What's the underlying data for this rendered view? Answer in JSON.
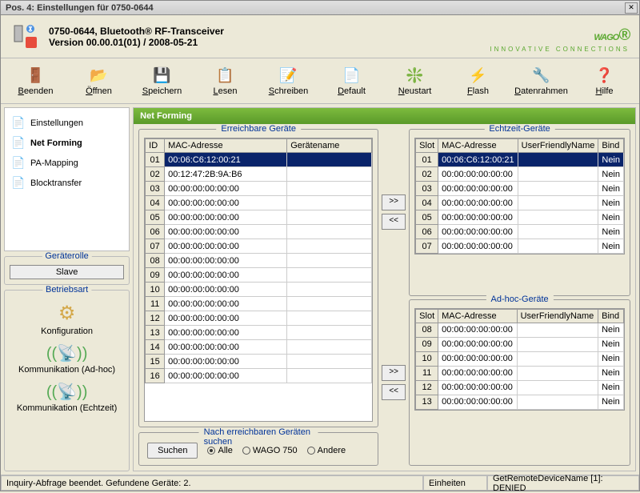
{
  "window": {
    "title": "Pos. 4: Einstellungen für 0750-0644"
  },
  "header": {
    "line1": "0750-0644, Bluetooth® RF-Transceiver",
    "line2": "Version 00.00.01(01) / 2008-05-21",
    "logo": "WAGO",
    "logo_sub": "INNOVATIVE CONNECTIONS"
  },
  "toolbar": [
    {
      "label": "Beenden"
    },
    {
      "label": "Öffnen"
    },
    {
      "label": "Speichern"
    },
    {
      "label": "Lesen"
    },
    {
      "label": "Schreiben"
    },
    {
      "label": "Default"
    },
    {
      "label": "Neustart"
    },
    {
      "label": "Flash"
    },
    {
      "label": "Datenrahmen"
    },
    {
      "label": "Hilfe"
    }
  ],
  "nav": [
    {
      "label": "Einstellungen",
      "sel": false
    },
    {
      "label": "Net Forming",
      "sel": true
    },
    {
      "label": "PA-Mapping",
      "sel": false
    },
    {
      "label": "Blocktransfer",
      "sel": false
    }
  ],
  "role": {
    "title": "Geräterolle",
    "value": "Slave"
  },
  "mode": {
    "title": "Betriebsart",
    "items": [
      "Konfiguration",
      "Kommunikation (Ad-hoc)",
      "Kommunikation (Echtzeit)"
    ]
  },
  "panel": {
    "title": "Net Forming"
  },
  "reachable": {
    "title": "Erreichbare Geräte",
    "cols": [
      "ID",
      "MAC-Adresse",
      "Gerätename"
    ],
    "rows": [
      {
        "id": "01",
        "mac": "00:06:C6:12:00:21",
        "name": "",
        "sel": true
      },
      {
        "id": "02",
        "mac": "00:12:47:2B:9A:B6",
        "name": "",
        "sel": false
      },
      {
        "id": "03",
        "mac": "00:00:00:00:00:00",
        "name": "",
        "sel": false
      },
      {
        "id": "04",
        "mac": "00:00:00:00:00:00",
        "name": "",
        "sel": false
      },
      {
        "id": "05",
        "mac": "00:00:00:00:00:00",
        "name": "",
        "sel": false
      },
      {
        "id": "06",
        "mac": "00:00:00:00:00:00",
        "name": "",
        "sel": false
      },
      {
        "id": "07",
        "mac": "00:00:00:00:00:00",
        "name": "",
        "sel": false
      },
      {
        "id": "08",
        "mac": "00:00:00:00:00:00",
        "name": "",
        "sel": false
      },
      {
        "id": "09",
        "mac": "00:00:00:00:00:00",
        "name": "",
        "sel": false
      },
      {
        "id": "10",
        "mac": "00:00:00:00:00:00",
        "name": "",
        "sel": false
      },
      {
        "id": "11",
        "mac": "00:00:00:00:00:00",
        "name": "",
        "sel": false
      },
      {
        "id": "12",
        "mac": "00:00:00:00:00:00",
        "name": "",
        "sel": false
      },
      {
        "id": "13",
        "mac": "00:00:00:00:00:00",
        "name": "",
        "sel": false
      },
      {
        "id": "14",
        "mac": "00:00:00:00:00:00",
        "name": "",
        "sel": false
      },
      {
        "id": "15",
        "mac": "00:00:00:00:00:00",
        "name": "",
        "sel": false
      },
      {
        "id": "16",
        "mac": "00:00:00:00:00:00",
        "name": "",
        "sel": false
      }
    ]
  },
  "realtime": {
    "title": "Echtzeit-Geräte",
    "cols": [
      "Slot",
      "MAC-Adresse",
      "UserFriendlyName",
      "Bind"
    ],
    "rows": [
      {
        "id": "01",
        "mac": "00:06:C6:12:00:21",
        "name": "",
        "bind": "Nein",
        "sel": true
      },
      {
        "id": "02",
        "mac": "00:00:00:00:00:00",
        "name": "",
        "bind": "Nein",
        "sel": false
      },
      {
        "id": "03",
        "mac": "00:00:00:00:00:00",
        "name": "",
        "bind": "Nein",
        "sel": false
      },
      {
        "id": "04",
        "mac": "00:00:00:00:00:00",
        "name": "",
        "bind": "Nein",
        "sel": false
      },
      {
        "id": "05",
        "mac": "00:00:00:00:00:00",
        "name": "",
        "bind": "Nein",
        "sel": false
      },
      {
        "id": "06",
        "mac": "00:00:00:00:00:00",
        "name": "",
        "bind": "Nein",
        "sel": false
      },
      {
        "id": "07",
        "mac": "00:00:00:00:00:00",
        "name": "",
        "bind": "Nein",
        "sel": false
      }
    ]
  },
  "adhoc": {
    "title": "Ad-hoc-Geräte",
    "cols": [
      "Slot",
      "MAC-Adresse",
      "UserFriendlyName",
      "Bind"
    ],
    "rows": [
      {
        "id": "08",
        "mac": "00:00:00:00:00:00",
        "name": "",
        "bind": "Nein",
        "sel": false
      },
      {
        "id": "09",
        "mac": "00:00:00:00:00:00",
        "name": "",
        "bind": "Nein",
        "sel": false
      },
      {
        "id": "10",
        "mac": "00:00:00:00:00:00",
        "name": "",
        "bind": "Nein",
        "sel": false
      },
      {
        "id": "11",
        "mac": "00:00:00:00:00:00",
        "name": "",
        "bind": "Nein",
        "sel": false
      },
      {
        "id": "12",
        "mac": "00:00:00:00:00:00",
        "name": "",
        "bind": "Nein",
        "sel": false
      },
      {
        "id": "13",
        "mac": "00:00:00:00:00:00",
        "name": "",
        "bind": "Nein",
        "sel": false
      }
    ]
  },
  "search": {
    "title": "Nach erreichbaren Geräten suchen",
    "button": "Suchen",
    "options": [
      "Alle",
      "WAGO 750",
      "Andere"
    ],
    "selected": 0
  },
  "arrows": {
    "add": ">>",
    "remove": "<<"
  },
  "status": {
    "msg": "Inquiry-Abfrage beendet. Gefundene Geräte: 2.",
    "units": "Einheiten",
    "result": "GetRemoteDeviceName [1]: DENIED"
  }
}
